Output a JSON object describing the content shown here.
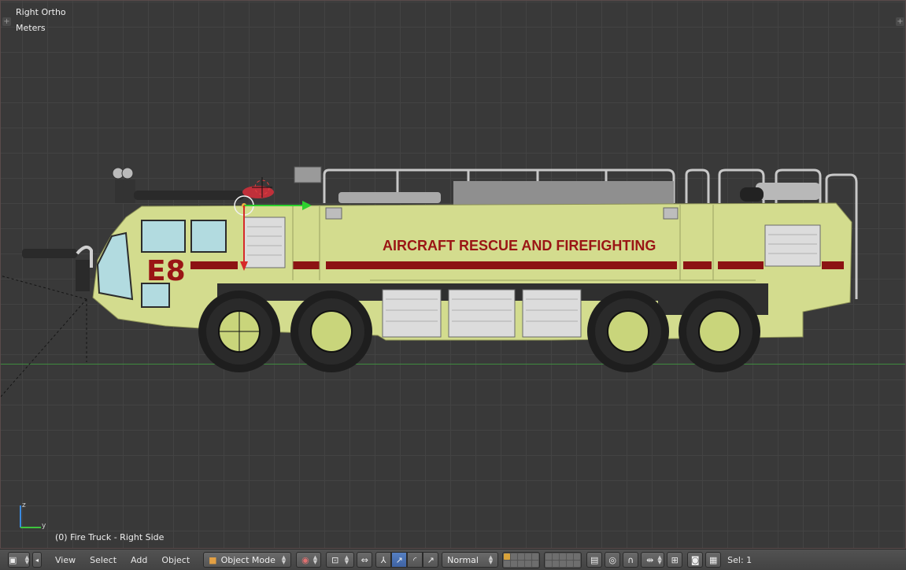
{
  "viewport": {
    "view_name": "Right Ortho",
    "units": "Meters",
    "object_info": "(0) Fire Truck - Right Side",
    "axis_labels": {
      "z": "z",
      "y": "y"
    }
  },
  "truck": {
    "number": "E8",
    "side_text": "AIRCRAFT RESCUE AND FIREFIGHTING",
    "body_color": "#d3dc8e",
    "stripe_color": "#8c1313",
    "tire_color": "#1e1e1e"
  },
  "header": {
    "menus": [
      "View",
      "Select",
      "Add",
      "Object"
    ],
    "mode": "Object Mode",
    "transform_orientation": "Normal",
    "selection_info": "Sel: 1"
  },
  "colors": {
    "viewport_bg": "#393939",
    "grid": "#434343",
    "ground_line": "#3f8a3f",
    "header_bg": "#4b4b4b",
    "active_button": "#5680c2"
  }
}
